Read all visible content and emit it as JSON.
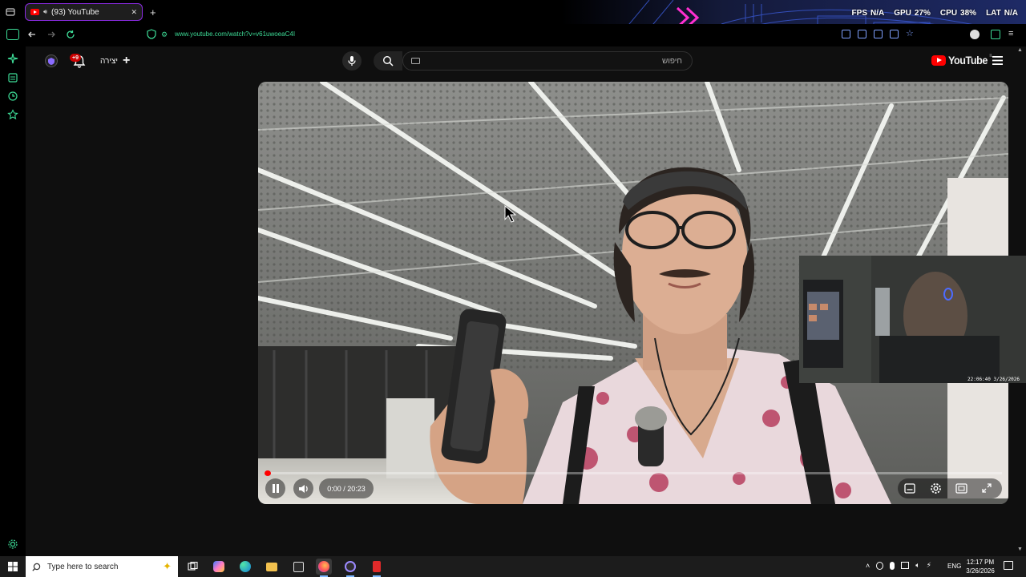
{
  "browser": {
    "tab": {
      "title": "(93) YouTube",
      "close": "✕",
      "new_tab": "+"
    },
    "url": "www.youtube.com/watch?v=v61uwoeaC4I",
    "hud": [
      {
        "label": "FPS",
        "value": "N/A"
      },
      {
        "label": "GPU",
        "value": "27%"
      },
      {
        "label": "CPU",
        "value": "38%"
      },
      {
        "label": "LAT",
        "value": "N/A"
      }
    ]
  },
  "youtube": {
    "search_placeholder": "חיפוש",
    "create_label": "יצירה",
    "create_icon": "+",
    "notification_count": "+9",
    "logo_text": "YouTube",
    "logo_region": "IL"
  },
  "player": {
    "time": "0:00 / 20:23",
    "progress": 0.0
  },
  "webcam": {
    "timestamp": "22:06:40 3/26/2026"
  },
  "taskbar": {
    "search_placeholder": "Type here to search",
    "lang": "ENG",
    "time": "12:17 PM",
    "date": "3/26/2026"
  },
  "colors": {
    "youtube_red": "#ff0000",
    "browser_accent": "#8a2be2",
    "url_green": "#3ddc97",
    "page_bg": "#0f0f0f"
  },
  "icons": [
    "workspace-icon",
    "back-icon",
    "forward-icon",
    "reload-icon",
    "shield-icon",
    "search-icon",
    "mic-icon",
    "bell-icon",
    "menu-icon",
    "pause-icon",
    "volume-icon",
    "subtitles-icon",
    "gear-icon",
    "theater-icon",
    "fullscreen-icon",
    "windows-icon"
  ]
}
